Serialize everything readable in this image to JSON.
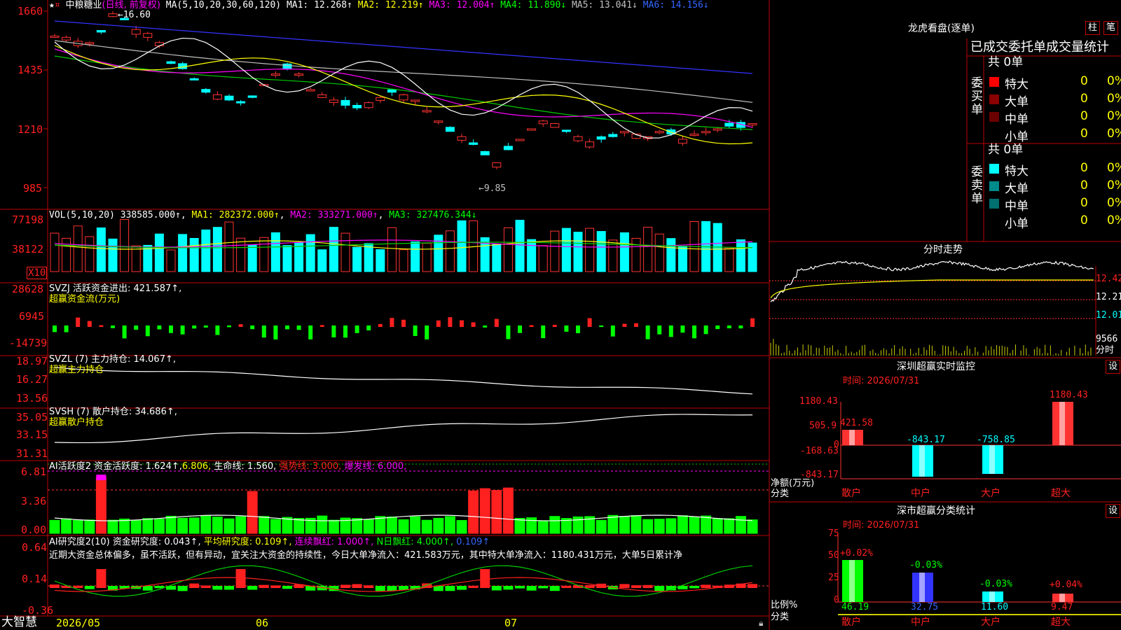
{
  "header": {
    "stock_name": "中粮糖业",
    "period": "(日线, 前复权)",
    "ma_label": "MA(5,10,20,30,60,120)",
    "ma1": "MA1: 12.268↑",
    "ma2": "MA2: 12.219↑",
    "ma3": "MA3: 12.004↑",
    "ma4": "MA4: 11.890↓",
    "ma5": "MA5: 13.041↓",
    "ma6": "MA6: 14.156↓",
    "hi_mark": "16.60",
    "lo_mark": "←9.85"
  },
  "price_axis": [
    "1660",
    "1435",
    "1210",
    "985"
  ],
  "vol": {
    "title": "VOL(5,10,20)",
    "val": "338585.000↑",
    "ma1": "MA1: 282372.000↑",
    "ma2": "MA2: 333271.000↑",
    "ma3": "MA3: 327476.344↓",
    "axis": [
      "77198",
      "38122"
    ],
    "x10": "X10"
  },
  "svzj": {
    "title": "SVZJ  活跃资金进出: 421.587↑,",
    "sub": "超赢资金流(万元)",
    "axis": [
      "28628",
      "6945",
      "-14739"
    ]
  },
  "svzl": {
    "title": "SVZL (7) 主力持仓: 14.067↑,",
    "sub": "超赢主力持仓",
    "axis": [
      "18.97",
      "16.27",
      "13.56"
    ]
  },
  "svsh": {
    "title": "SVSH (7) 散户持仓: 34.686↑,",
    "sub": "超赢散户持仓",
    "axis": [
      "35.05",
      "33.15",
      "31.31"
    ]
  },
  "ai1": {
    "title": "AI活跃度2",
    "t1": "资金活跃度: 1.624↑,",
    "t2": "6.806,",
    "t3": "生命线: 1.560,",
    "t4": "强势线: 3.000,",
    "t5": "爆发线: 6.000,",
    "axis": [
      "6.81",
      "3.36",
      "0.00"
    ]
  },
  "ai2": {
    "title": "AI研究度2(10)",
    "t1": "资金研究度: 0.043↑,",
    "t2": "平均研究度: 0.109↑,",
    "t3": "连续飘红: 1.000↑,",
    "t4": "N日飘红: 4.000↑,",
    "t5": "0.109↑",
    "desc": "近期大资金总体偏多，虽不活跃，但有异动，宜关注大资金的持续性，今日大单净流入：421.583万元，其中特大单净流入：1180.431万元，大单5日累计净",
    "axis": [
      "0.64",
      "0.14",
      "-0.36"
    ]
  },
  "bottom": {
    "brand": "大智慧",
    "dates": [
      "2026/05",
      "06",
      "07"
    ]
  },
  "right": {
    "lh_title": "龙虎看盘(逐单)",
    "tab1": "柱",
    "tab2": "笔",
    "header_tabs": "已成交委托单成交量统计",
    "buy_label": "委买单",
    "sell_label": "委卖单",
    "buy_total": "共 0单",
    "sell_total": "共 0单",
    "buy_rows": [
      {
        "name": "特大",
        "count": "0",
        "pct": "0%",
        "color": "#ff0000"
      },
      {
        "name": "大单",
        "count": "0",
        "pct": "0%",
        "color": "#8b0000"
      },
      {
        "name": "中单",
        "count": "0",
        "pct": "0%",
        "color": "#6b0000"
      },
      {
        "name": "小单",
        "count": "0",
        "pct": "0%",
        "color": "#000000"
      }
    ],
    "sell_rows": [
      {
        "name": "特大",
        "count": "0",
        "pct": "0%",
        "color": "#00ffff"
      },
      {
        "name": "大单",
        "count": "0",
        "pct": "0%",
        "color": "#008b8b"
      },
      {
        "name": "中单",
        "count": "0",
        "pct": "0%",
        "color": "#007070"
      },
      {
        "name": "小单",
        "count": "0",
        "pct": "0%",
        "color": "#000000"
      }
    ],
    "fenshi_title": "分时走势",
    "fenshi_axis": [
      "12.42",
      "12.21",
      "12.01"
    ],
    "fenshi_vol": "9566",
    "fenshi_lbl": "分时",
    "sz_title": "深圳超赢实时监控",
    "sz_set": "设",
    "sz_time": "时间: 2026/07/31",
    "sz_axis": [
      "1180.43",
      "505.9",
      "0",
      "-168.63",
      "-843.17"
    ],
    "sz_unit1": "净额(万元)",
    "sz_unit2": "分类",
    "sz_vals": [
      "421.58",
      "-843.17",
      "-758.85",
      "1180.43"
    ],
    "cats": [
      "散户",
      "中户",
      "大户",
      "超大"
    ],
    "fl_title": "深市超赢分类统计",
    "fl_set": "设",
    "fl_time": "时间: 2026/07/31",
    "fl_axis": [
      "75",
      "50",
      "25",
      "0"
    ],
    "fl_unit1": "比例%",
    "fl_unit2": "分类",
    "fl_chg": [
      "+0.02%",
      "-0.03%",
      "-0.03%",
      "+0.04%"
    ],
    "fl_vals": [
      "46.19",
      "32.75",
      "11.60",
      "9.47"
    ]
  }
}
